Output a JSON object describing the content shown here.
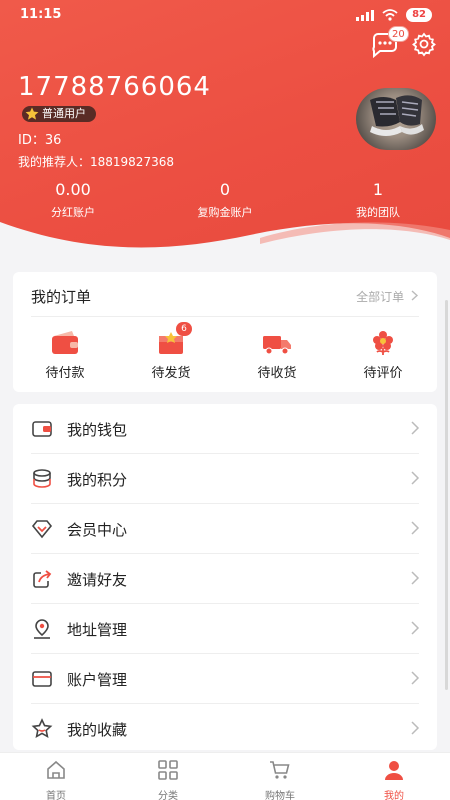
{
  "status": {
    "time": "11:15",
    "battery": "82"
  },
  "header": {
    "message_count": "20",
    "phone": "17788766064",
    "level": "普通用户",
    "uid": "ID：36",
    "referrer": "我的推荐人：18819827368"
  },
  "stats": [
    {
      "value": "0.00",
      "label": "分红账户"
    },
    {
      "value": "0",
      "label": "复购金账户"
    },
    {
      "value": "1",
      "label": "我的团队"
    }
  ],
  "orders": {
    "title": "我的订单",
    "all_label": "全部订单",
    "items": [
      {
        "label": "待付款",
        "icon": "wallet-icon",
        "badge": ""
      },
      {
        "label": "待发货",
        "icon": "box-icon",
        "badge": "6"
      },
      {
        "label": "待收货",
        "icon": "truck-icon",
        "badge": ""
      },
      {
        "label": "待评价",
        "icon": "flower-icon",
        "badge": ""
      }
    ]
  },
  "menu": [
    {
      "label": "我的钱包",
      "icon": "wallet-icon"
    },
    {
      "label": "我的积分",
      "icon": "coins-icon"
    },
    {
      "label": "会员中心",
      "icon": "diamond-icon"
    },
    {
      "label": "邀请好友",
      "icon": "share-icon"
    },
    {
      "label": "地址管理",
      "icon": "location-icon"
    },
    {
      "label": "账户管理",
      "icon": "card-icon"
    },
    {
      "label": "我的收藏",
      "icon": "star-icon"
    }
  ],
  "tabs": [
    {
      "label": "首页",
      "icon": "home-icon"
    },
    {
      "label": "分类",
      "icon": "grid-icon"
    },
    {
      "label": "购物车",
      "icon": "cart-icon"
    },
    {
      "label": "我的",
      "icon": "user-icon"
    }
  ],
  "colors": {
    "accent": "#ef4f43",
    "header": "#ec4f42"
  }
}
